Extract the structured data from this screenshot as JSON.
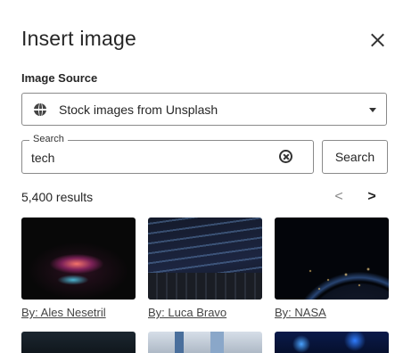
{
  "dialog": {
    "title": "Insert image",
    "close_icon": "close-icon"
  },
  "image_source": {
    "label": "Image Source",
    "icon": "globe-icon",
    "selected": "Stock images from Unsplash"
  },
  "search": {
    "legend": "Search",
    "value": "tech",
    "button_label": "Search",
    "clear_icon": "clear-circle-icon"
  },
  "results": {
    "count_text": "5,400 results",
    "prev_symbol": "<",
    "next_symbol": ">"
  },
  "images": [
    {
      "credit": "By: Ales Nesetril"
    },
    {
      "credit": "By: Luca Bravo"
    },
    {
      "credit": "By: NASA"
    }
  ]
}
